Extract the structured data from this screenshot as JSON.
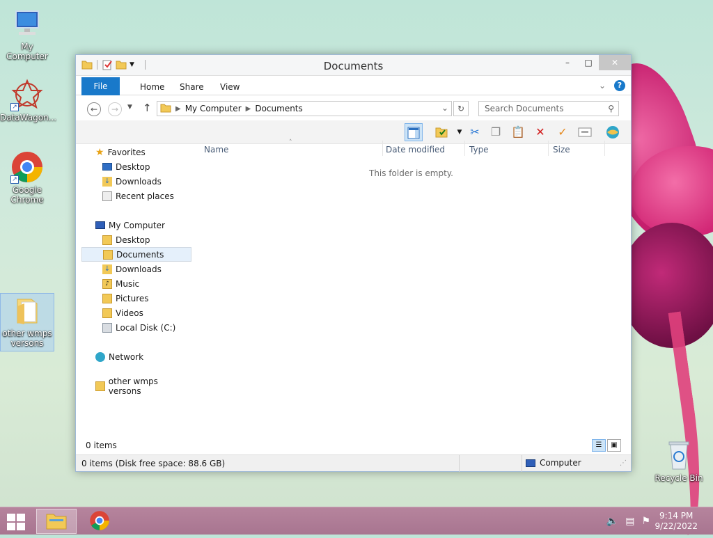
{
  "desktop": {
    "icons": [
      {
        "label": "My Computer",
        "icon": "monitor-icon"
      },
      {
        "label": "DataWagon...",
        "icon": "datawagon-icon"
      },
      {
        "label": "Google Chrome",
        "icon": "chrome-icon"
      },
      {
        "label": "other wmps versons",
        "icon": "folder-icon"
      },
      {
        "label": "Recycle Bin",
        "icon": "recycle-bin-icon"
      }
    ]
  },
  "window": {
    "title": "Documents",
    "controls": {
      "minimize": "–",
      "maximize": "□",
      "close": "✕"
    },
    "ribbon": {
      "file": "File",
      "tabs": [
        "Home",
        "Share",
        "View"
      ]
    },
    "address": {
      "crumbs": [
        "My Computer",
        "Documents"
      ]
    },
    "search": {
      "placeholder": "Search Documents"
    },
    "nav": {
      "favorites": {
        "label": "Favorites",
        "items": [
          "Desktop",
          "Downloads",
          "Recent places"
        ]
      },
      "computer": {
        "label": "My Computer",
        "items": [
          "Desktop",
          "Documents",
          "Downloads",
          "Music",
          "Pictures",
          "Videos",
          "Local Disk (C:)"
        ]
      },
      "network": "Network",
      "folder": "other wmps versons"
    },
    "columns": [
      "Name",
      "Date modified",
      "Type",
      "Size"
    ],
    "empty_message": "This folder is empty.",
    "status": {
      "items": "0 items",
      "detail": "0 items (Disk free space: 88.6 GB)",
      "zone": "Computer"
    }
  },
  "taskbar": {
    "time": "9:14 PM",
    "date": "9/22/2022"
  }
}
